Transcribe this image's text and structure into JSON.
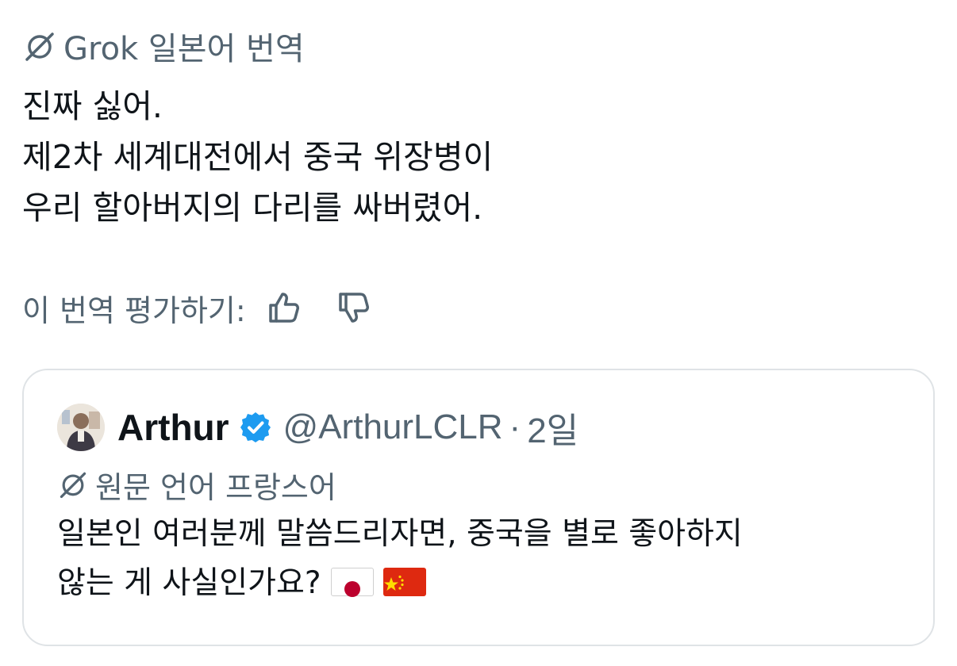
{
  "grok_header": {
    "icon": "grok-slash-icon",
    "label": "Grok 일본어 번역"
  },
  "translation": {
    "lines": [
      "진짜 싫어.",
      "제2차 세계대전에서 중국 위장병이",
      "우리 할아버지의 다리를 싸버렸어."
    ]
  },
  "rating": {
    "label": "이 번역 평가하기:",
    "thumb_up_icon": "thumbs-up-icon",
    "thumb_down_icon": "thumbs-down-icon"
  },
  "quote": {
    "name": "Arthur",
    "verified_icon": "verified-badge-icon",
    "handle": "@ArthurLCLR",
    "separator": "·",
    "time": "2일",
    "source_label": "원문 언어 프랑스어",
    "body_lines": [
      "일본인 여러분께 말씀드리자면, 중국을 별로 좋아하지",
      "않는 게 사실인가요?"
    ],
    "flags": [
      "japan-flag-icon",
      "china-flag-icon"
    ]
  },
  "colors": {
    "text": "#0f1419",
    "muted": "#536471",
    "verified": "#1d9bf0",
    "border": "#dfe3e6"
  }
}
